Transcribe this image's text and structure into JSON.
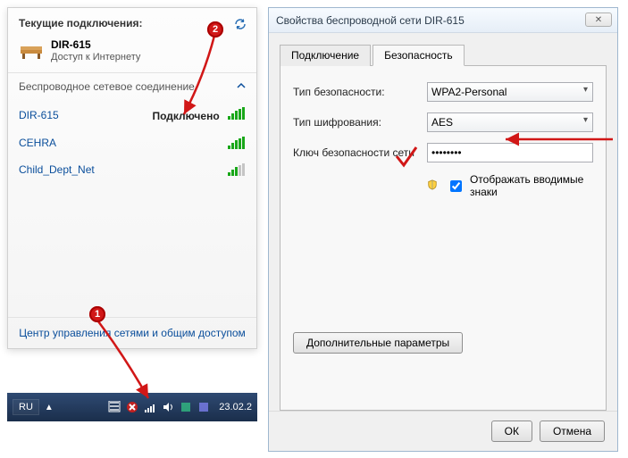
{
  "popup": {
    "header": "Текущие подключения:",
    "current": {
      "name": "DIR-615",
      "status": "Доступ к Интернету"
    },
    "section": "Беспроводное сетевое соединение",
    "networks": [
      {
        "ssid": "DIR-615",
        "status": "Подключено",
        "strength": "full"
      },
      {
        "ssid": "CEHRA",
        "status": "",
        "strength": "full"
      },
      {
        "ssid": "Child_Dept_Net",
        "status": "",
        "strength": "weak"
      }
    ],
    "footer_link": "Центр управления сетями и общим доступом"
  },
  "taskbar": {
    "lang": "RU",
    "date": "23.02.2"
  },
  "dialog": {
    "title": "Свойства беспроводной сети DIR-615",
    "tabs": {
      "connect": "Подключение",
      "security": "Безопасность"
    },
    "labels": {
      "sec_type": "Тип безопасности:",
      "enc_type": "Тип шифрования:",
      "key": "Ключ безопасности сети"
    },
    "values": {
      "sec_type": "WPA2-Personal",
      "enc_type": "AES",
      "key": "••••••••"
    },
    "show_chars": "Отображать вводимые знаки",
    "advanced_btn": "Дополнительные параметры",
    "ok": "ОК",
    "cancel": "Отмена"
  },
  "annotations": {
    "b1": "1",
    "b2": "2"
  }
}
